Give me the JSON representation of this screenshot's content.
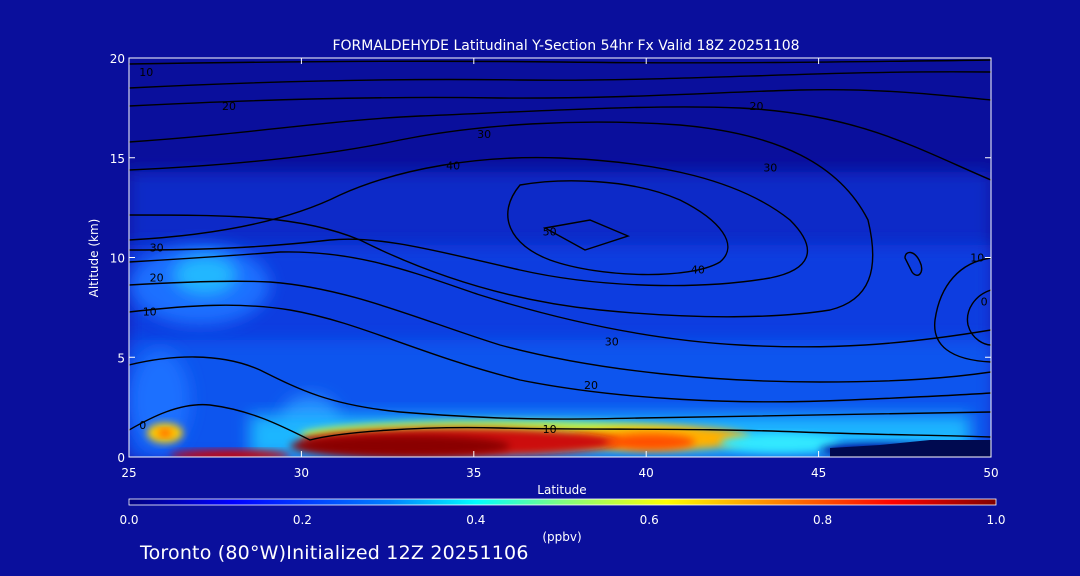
{
  "chart_data": {
    "type": "heatmap",
    "title": "FORMALDEHYDE Latitudinal Y-Section 54hr  Fx Valid 18Z 20251108",
    "xlabel": "Latitude",
    "ylabel": "Altitude (km)",
    "xlim": [
      25,
      50
    ],
    "ylim": [
      0,
      20
    ],
    "x_ticks": [
      "25",
      "30",
      "35",
      "40",
      "45",
      "50"
    ],
    "y_ticks": [
      "0",
      "5",
      "10",
      "15",
      "20"
    ],
    "colorbar": {
      "label": "(ppbv)",
      "range": [
        0.0,
        1.0
      ],
      "ticks": [
        "0.0",
        "0.2",
        "0.4",
        "0.6",
        "0.8",
        "1.0"
      ],
      "colors": [
        "#00007f",
        "#0000ff",
        "#0080ff",
        "#00ffff",
        "#80ff80",
        "#ffff00",
        "#ff8000",
        "#ff0000",
        "#800000"
      ]
    },
    "field_hotspots": [
      {
        "lat": 26.0,
        "alt": 1.2,
        "value": 0.7
      },
      {
        "lat": 27.2,
        "alt": 9.3,
        "value": 0.35
      },
      {
        "lat": 33.5,
        "alt": 0.8,
        "value": 1.0
      },
      {
        "lat": 37.5,
        "alt": 1.0,
        "value": 0.95
      },
      {
        "lat": 40.3,
        "alt": 0.7,
        "value": 0.85
      },
      {
        "lat": 43.0,
        "alt": 0.8,
        "value": 0.45
      },
      {
        "lat": 27.0,
        "alt": 3.0,
        "value": 0.25
      }
    ],
    "contour_labels": [
      {
        "text": "10",
        "lat": 25.5,
        "alt": 19.3
      },
      {
        "text": "20",
        "lat": 27.9,
        "alt": 17.6
      },
      {
        "text": "30",
        "lat": 35.3,
        "alt": 16.2
      },
      {
        "text": "40",
        "lat": 34.4,
        "alt": 14.6
      },
      {
        "text": "50",
        "lat": 37.2,
        "alt": 11.3
      },
      {
        "text": "20",
        "lat": 43.2,
        "alt": 17.6
      },
      {
        "text": "30",
        "lat": 43.6,
        "alt": 14.5
      },
      {
        "text": "40",
        "lat": 41.5,
        "alt": 9.4
      },
      {
        "text": "30",
        "lat": 25.8,
        "alt": 10.5
      },
      {
        "text": "20",
        "lat": 25.8,
        "alt": 9.0
      },
      {
        "text": "10",
        "lat": 25.6,
        "alt": 7.3
      },
      {
        "text": "30",
        "lat": 39.0,
        "alt": 5.8
      },
      {
        "text": "20",
        "lat": 38.4,
        "alt": 3.6
      },
      {
        "text": "10",
        "lat": 37.2,
        "alt": 1.4
      },
      {
        "text": "0",
        "lat": 25.4,
        "alt": 1.6
      },
      {
        "text": "10",
        "lat": 49.6,
        "alt": 10.0
      },
      {
        "text": "0",
        "lat": 49.8,
        "alt": 7.8
      }
    ]
  },
  "footer": "Toronto (80°W)Initialized 12Z 20251106"
}
